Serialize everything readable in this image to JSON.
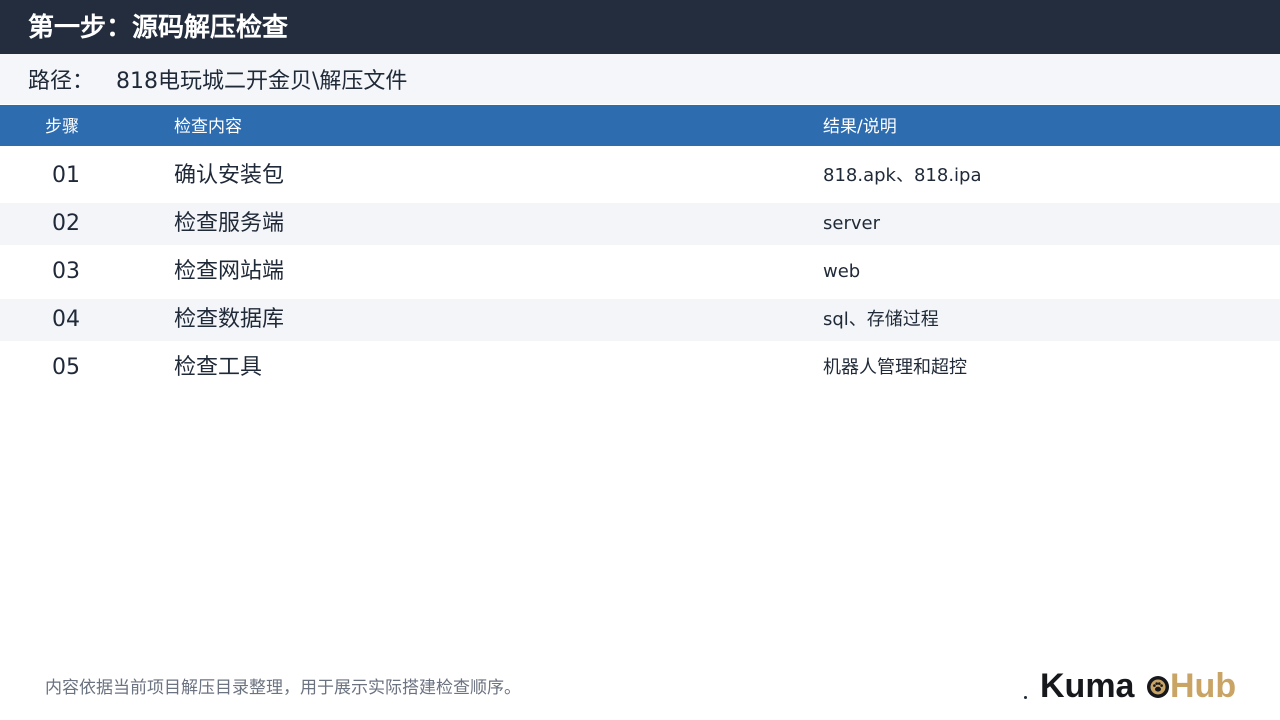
{
  "header": {
    "title": "第一步：源码解压检查"
  },
  "path": {
    "label": "路径：",
    "value": "818电玩城二开金贝\\解压文件"
  },
  "table": {
    "columns": [
      "步骤",
      "检查内容",
      "结果/说明"
    ],
    "rows": [
      {
        "step": "01",
        "item": "确认安装包",
        "result": "818.apk、818.ipa"
      },
      {
        "step": "02",
        "item": "检查服务端",
        "result": "server"
      },
      {
        "step": "03",
        "item": "检查网站端",
        "result": "web"
      },
      {
        "step": "04",
        "item": "检查数据库",
        "result": "sql、存储过程"
      },
      {
        "step": "05",
        "item": "检查工具",
        "result": "机器人管理和超控"
      }
    ]
  },
  "footer": {
    "note": "内容依据当前项目解压目录整理，用于展示实际搭建检查顺序。"
  },
  "logo": {
    "part1": "Kuma",
    "part2": "Hub",
    "icon": "paw-icon",
    "colors": {
      "dark": "#16181c",
      "gold": "#c9a464"
    }
  },
  "colors": {
    "title_bar": "#232d3d",
    "table_header": "#2e6cb0",
    "alt_row": "#f3f5f8"
  }
}
